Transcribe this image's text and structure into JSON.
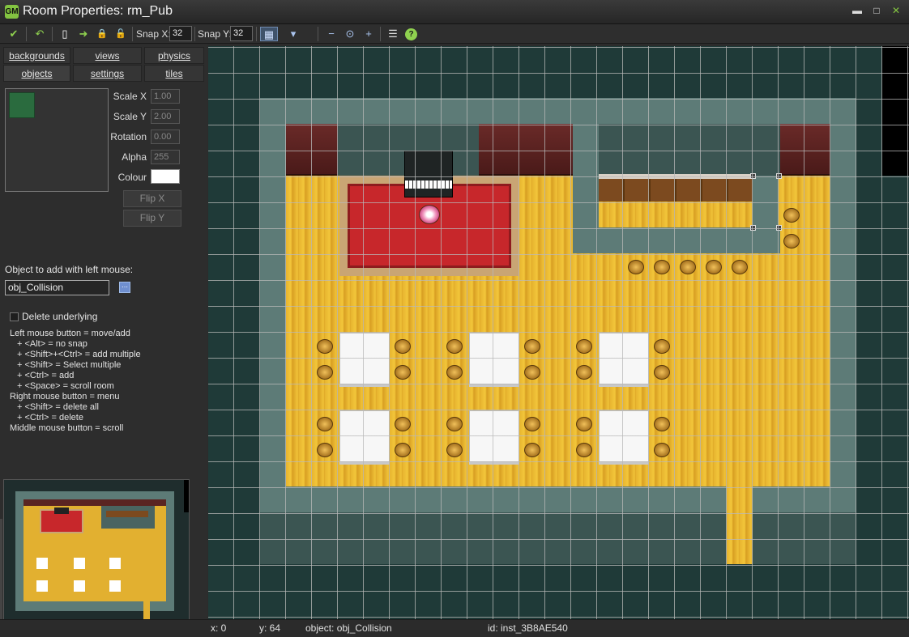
{
  "window": {
    "icon_text": "GM",
    "title": "Room Properties: rm_Pub",
    "minimize": "▬",
    "maximize": "□",
    "close": "✕"
  },
  "toolbar": {
    "confirm_icon": "✔",
    "undo_icon": "↶",
    "new_icon": "▯",
    "shift_icon": "➜",
    "lock_icon": "🔒",
    "unlock_icon": "🔓",
    "snap_x_label": "Snap X:",
    "snap_x_value": "32",
    "snap_y_label": "Snap Y:",
    "snap_y_value": "32",
    "grid_icon": "▦",
    "zoom_drop_icon": "▾",
    "zoom_out_icon": "−",
    "zoom_reset_icon": "⊙",
    "zoom_in_icon": "+",
    "list_icon": "☰",
    "help_icon": "?"
  },
  "tabs": {
    "row1": [
      "backgrounds",
      "views",
      "physics"
    ],
    "row2": [
      "objects",
      "settings",
      "tiles"
    ],
    "active": "objects"
  },
  "instance": {
    "scale_x_label": "Scale X",
    "scale_x_value": "1.00",
    "scale_y_label": "Scale Y",
    "scale_y_value": "2.00",
    "rotation_label": "Rotation",
    "rotation_value": "0.00",
    "alpha_label": "Alpha",
    "alpha_value": "255",
    "colour_label": "Colour",
    "colour_value": "#ffffff",
    "flip_x": "Flip X",
    "flip_y": "Flip Y",
    "preview_color": "#2a6b3e"
  },
  "object_to_add": {
    "label": "Object to add with left mouse:",
    "value": "obj_Collision",
    "browse_icon": "⋯"
  },
  "delete_underlying": {
    "label": "Delete underlying",
    "checked": false
  },
  "help_lines": [
    "Left mouse button = move/add",
    "+ <Alt> = no snap",
    "+ <Shift>+<Ctrl> = add multiple",
    "+ <Shift> = Select multiple",
    "+ <Ctrl> = add",
    "+ <Space> = scroll room",
    "Right mouse button = menu",
    "+ <Shift> = delete all",
    "+ <Ctrl> = delete",
    "Middle mouse button = scroll"
  ],
  "status": {
    "x": "x: 0",
    "y": "y: 64",
    "object": "object: obj_Collision",
    "id": "id: inst_3B8AE540"
  },
  "colors": {
    "accent_green": "#83c441",
    "floor": "#e8b530",
    "rug": "#c7272b",
    "wall": "#5d7b77",
    "void": "#1f3a38"
  }
}
